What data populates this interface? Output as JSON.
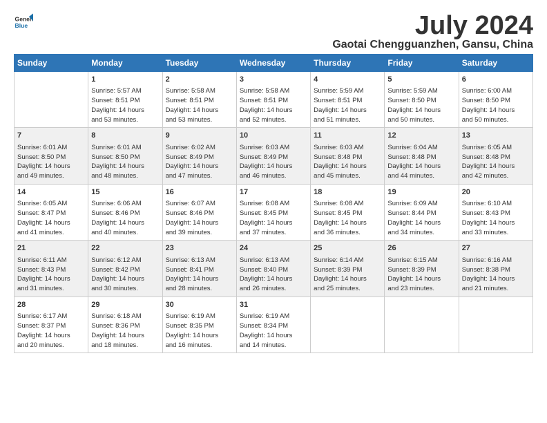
{
  "logo": {
    "line1": "General",
    "line2": "Blue"
  },
  "title": "July 2024",
  "subtitle": "Gaotai Chengguanzhen, Gansu, China",
  "days_header": [
    "Sunday",
    "Monday",
    "Tuesday",
    "Wednesday",
    "Thursday",
    "Friday",
    "Saturday"
  ],
  "weeks": [
    [
      {
        "day": "",
        "info": ""
      },
      {
        "day": "1",
        "info": "Sunrise: 5:57 AM\nSunset: 8:51 PM\nDaylight: 14 hours\nand 53 minutes."
      },
      {
        "day": "2",
        "info": "Sunrise: 5:58 AM\nSunset: 8:51 PM\nDaylight: 14 hours\nand 53 minutes."
      },
      {
        "day": "3",
        "info": "Sunrise: 5:58 AM\nSunset: 8:51 PM\nDaylight: 14 hours\nand 52 minutes."
      },
      {
        "day": "4",
        "info": "Sunrise: 5:59 AM\nSunset: 8:51 PM\nDaylight: 14 hours\nand 51 minutes."
      },
      {
        "day": "5",
        "info": "Sunrise: 5:59 AM\nSunset: 8:50 PM\nDaylight: 14 hours\nand 50 minutes."
      },
      {
        "day": "6",
        "info": "Sunrise: 6:00 AM\nSunset: 8:50 PM\nDaylight: 14 hours\nand 50 minutes."
      }
    ],
    [
      {
        "day": "7",
        "info": "Sunrise: 6:01 AM\nSunset: 8:50 PM\nDaylight: 14 hours\nand 49 minutes."
      },
      {
        "day": "8",
        "info": "Sunrise: 6:01 AM\nSunset: 8:50 PM\nDaylight: 14 hours\nand 48 minutes."
      },
      {
        "day": "9",
        "info": "Sunrise: 6:02 AM\nSunset: 8:49 PM\nDaylight: 14 hours\nand 47 minutes."
      },
      {
        "day": "10",
        "info": "Sunrise: 6:03 AM\nSunset: 8:49 PM\nDaylight: 14 hours\nand 46 minutes."
      },
      {
        "day": "11",
        "info": "Sunrise: 6:03 AM\nSunset: 8:48 PM\nDaylight: 14 hours\nand 45 minutes."
      },
      {
        "day": "12",
        "info": "Sunrise: 6:04 AM\nSunset: 8:48 PM\nDaylight: 14 hours\nand 44 minutes."
      },
      {
        "day": "13",
        "info": "Sunrise: 6:05 AM\nSunset: 8:48 PM\nDaylight: 14 hours\nand 42 minutes."
      }
    ],
    [
      {
        "day": "14",
        "info": "Sunrise: 6:05 AM\nSunset: 8:47 PM\nDaylight: 14 hours\nand 41 minutes."
      },
      {
        "day": "15",
        "info": "Sunrise: 6:06 AM\nSunset: 8:46 PM\nDaylight: 14 hours\nand 40 minutes."
      },
      {
        "day": "16",
        "info": "Sunrise: 6:07 AM\nSunset: 8:46 PM\nDaylight: 14 hours\nand 39 minutes."
      },
      {
        "day": "17",
        "info": "Sunrise: 6:08 AM\nSunset: 8:45 PM\nDaylight: 14 hours\nand 37 minutes."
      },
      {
        "day": "18",
        "info": "Sunrise: 6:08 AM\nSunset: 8:45 PM\nDaylight: 14 hours\nand 36 minutes."
      },
      {
        "day": "19",
        "info": "Sunrise: 6:09 AM\nSunset: 8:44 PM\nDaylight: 14 hours\nand 34 minutes."
      },
      {
        "day": "20",
        "info": "Sunrise: 6:10 AM\nSunset: 8:43 PM\nDaylight: 14 hours\nand 33 minutes."
      }
    ],
    [
      {
        "day": "21",
        "info": "Sunrise: 6:11 AM\nSunset: 8:43 PM\nDaylight: 14 hours\nand 31 minutes."
      },
      {
        "day": "22",
        "info": "Sunrise: 6:12 AM\nSunset: 8:42 PM\nDaylight: 14 hours\nand 30 minutes."
      },
      {
        "day": "23",
        "info": "Sunrise: 6:13 AM\nSunset: 8:41 PM\nDaylight: 14 hours\nand 28 minutes."
      },
      {
        "day": "24",
        "info": "Sunrise: 6:13 AM\nSunset: 8:40 PM\nDaylight: 14 hours\nand 26 minutes."
      },
      {
        "day": "25",
        "info": "Sunrise: 6:14 AM\nSunset: 8:39 PM\nDaylight: 14 hours\nand 25 minutes."
      },
      {
        "day": "26",
        "info": "Sunrise: 6:15 AM\nSunset: 8:39 PM\nDaylight: 14 hours\nand 23 minutes."
      },
      {
        "day": "27",
        "info": "Sunrise: 6:16 AM\nSunset: 8:38 PM\nDaylight: 14 hours\nand 21 minutes."
      }
    ],
    [
      {
        "day": "28",
        "info": "Sunrise: 6:17 AM\nSunset: 8:37 PM\nDaylight: 14 hours\nand 20 minutes."
      },
      {
        "day": "29",
        "info": "Sunrise: 6:18 AM\nSunset: 8:36 PM\nDaylight: 14 hours\nand 18 minutes."
      },
      {
        "day": "30",
        "info": "Sunrise: 6:19 AM\nSunset: 8:35 PM\nDaylight: 14 hours\nand 16 minutes."
      },
      {
        "day": "31",
        "info": "Sunrise: 6:19 AM\nSunset: 8:34 PM\nDaylight: 14 hours\nand 14 minutes."
      },
      {
        "day": "",
        "info": ""
      },
      {
        "day": "",
        "info": ""
      },
      {
        "day": "",
        "info": ""
      }
    ]
  ]
}
